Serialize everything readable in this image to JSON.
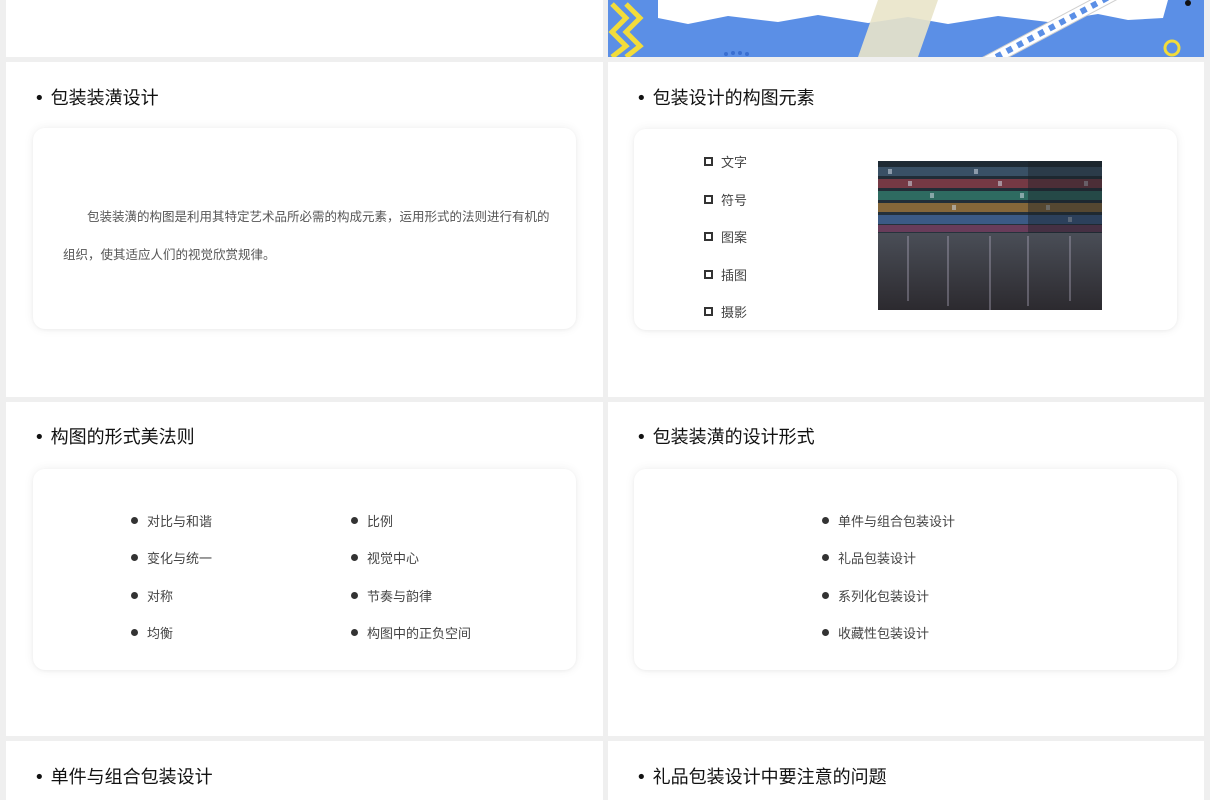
{
  "slides": {
    "s1": {
      "title": "包装装潢设计",
      "paragraph": "包装装潢的构图是利用其特定艺术品所必需的构成元素，运用形式的法则进行有机的组织，使其适应人们的视觉欣赏规律。"
    },
    "s2": {
      "title": "包装设计的构图元素",
      "items": [
        "文字",
        "符号",
        "图案",
        "插图",
        "摄影"
      ],
      "image_icon": "supermarket-shelves-photo"
    },
    "s3": {
      "title": "构图的形式美法则",
      "left": [
        "对比与和谐",
        "变化与统一",
        "对称",
        "均衡"
      ],
      "right": [
        "比例",
        "视觉中心",
        "节奏与韵律",
        "构图中的正负空间"
      ]
    },
    "s4": {
      "title": "包装装潢的设计形式",
      "items": [
        "单件与组合包装设计",
        "礼品包装设计",
        "系列化包装设计",
        "收藏性包装设计"
      ]
    },
    "s5": {
      "title": "单件与组合包装设计"
    },
    "s6": {
      "title": "礼品包装设计中要注意的问题"
    }
  },
  "colors": {
    "banner_blue": "#5b8fe6",
    "accent_yellow": "#f2dc3a",
    "page_bg": "#efefef"
  }
}
